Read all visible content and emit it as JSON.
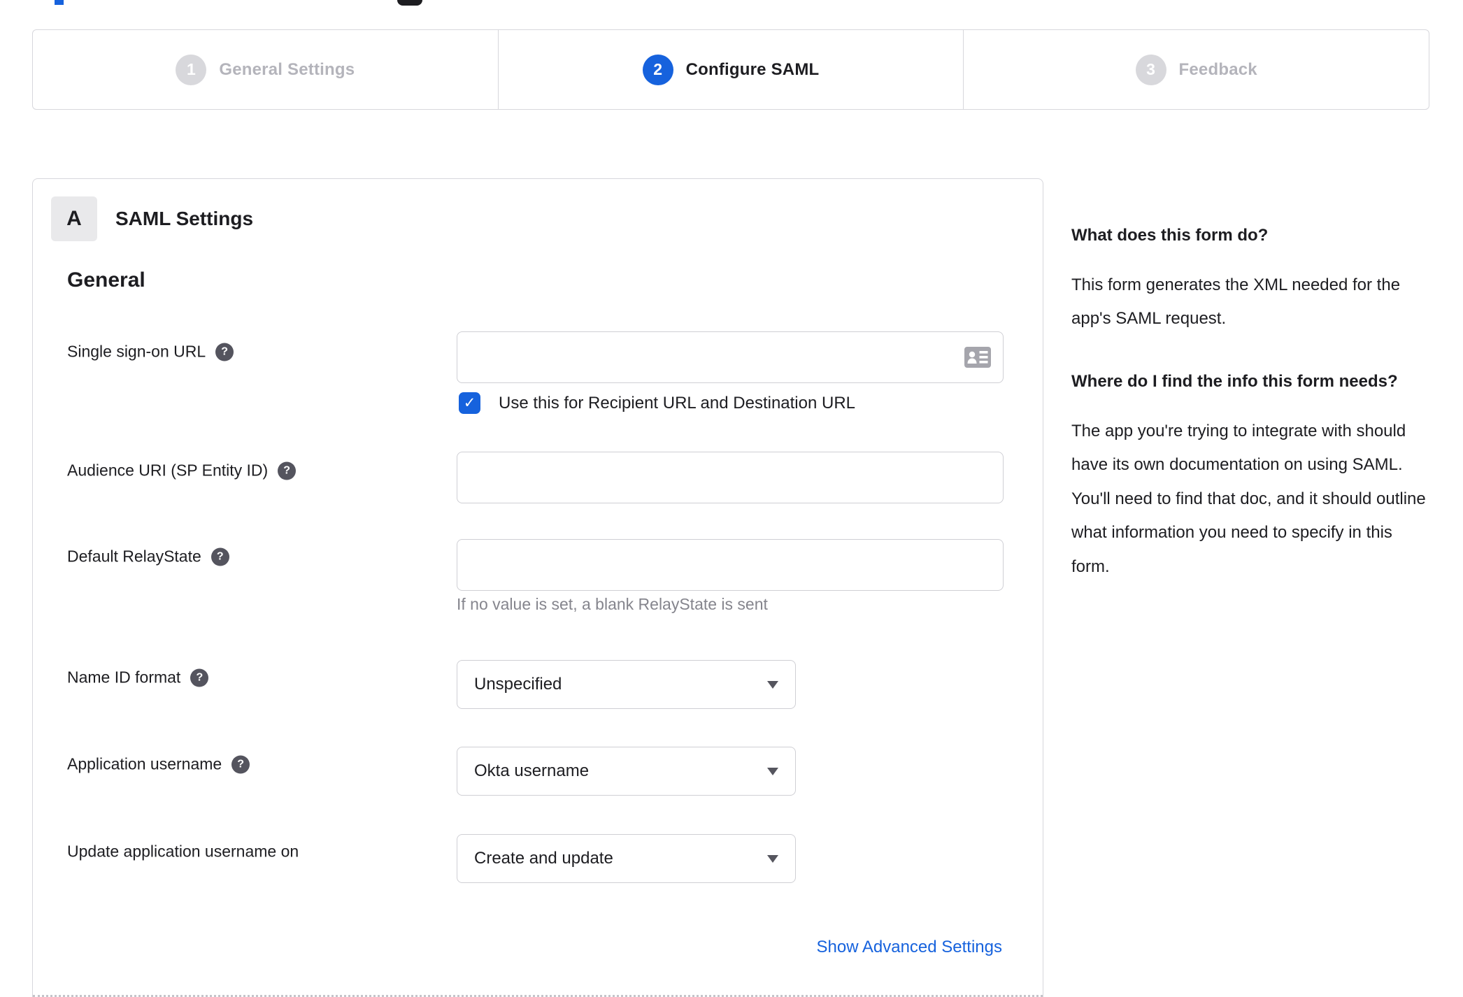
{
  "colors": {
    "accent_blue": "#1662dd",
    "border_gray": "#d7d7dc",
    "inactive_step_circle": "#d8d8dc",
    "inactive_step_label": "#b4b4bb",
    "helper_text_gray": "#85858d",
    "help_icon_gray": "#54545e",
    "text": "#1d1d21"
  },
  "stepper": {
    "steps": [
      {
        "number": "1",
        "label": "General Settings",
        "state": "inactive"
      },
      {
        "number": "2",
        "label": "Configure SAML",
        "state": "active"
      },
      {
        "number": "3",
        "label": "Feedback",
        "state": "inactive"
      }
    ]
  },
  "panel": {
    "section_badge": "A",
    "section_title": "SAML Settings",
    "group_heading": "General",
    "fields": {
      "sso_url": {
        "label": "Single sign-on URL",
        "value": "",
        "has_help_icon": true,
        "right_icon": "contact-card-icon",
        "checkbox_label": "Use this for Recipient URL and Destination URL",
        "checkbox_checked": true,
        "checkmark_glyph": "✓"
      },
      "audience_uri": {
        "label": "Audience URI (SP Entity ID)",
        "value": "",
        "has_help_icon": true
      },
      "relay_state": {
        "label": "Default RelayState",
        "value": "",
        "has_help_icon": true,
        "helper": "If no value is set, a blank RelayState is sent"
      },
      "name_id_format": {
        "label": "Name ID format",
        "has_help_icon": true,
        "selected_value": "Unspecified"
      },
      "app_username": {
        "label": "Application username",
        "has_help_icon": true,
        "selected_value": "Okta username"
      },
      "update_username": {
        "label": "Update application username on",
        "has_help_icon": false,
        "selected_value": "Create and update"
      }
    },
    "help_icon_glyph": "?",
    "advanced_link_label": "Show Advanced Settings"
  },
  "help_panel": {
    "question_1": "What does this form do?",
    "answer_1": "This form generates the XML needed for the app's SAML request.",
    "question_2": "Where do I find the info this form needs?",
    "answer_2": "The app you're trying to integrate with should have its own documentation on using SAML. You'll need to find that doc, and it should outline what information you need to specify in this form."
  }
}
